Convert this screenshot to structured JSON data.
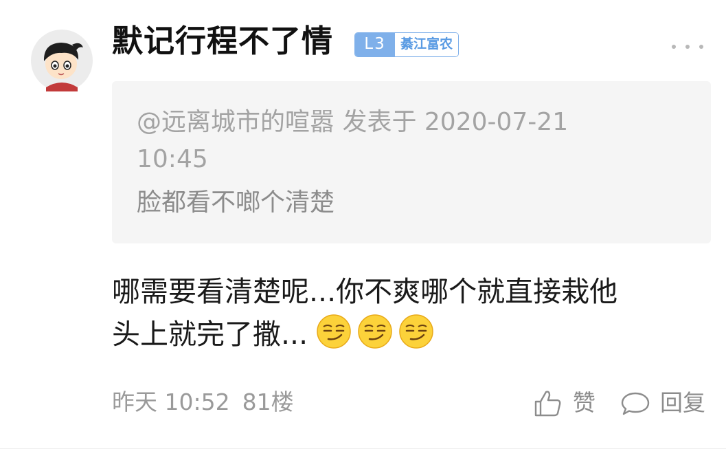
{
  "comment": {
    "username": "默记行程不了情",
    "badge": {
      "level": "L3",
      "title": "綦江富农",
      "color": "#7fb0ea"
    },
    "quote": {
      "meta": "@远离城市的喧嚣 发表于 2020-07-21 10:45",
      "body": "脸都看不啷个清楚"
    },
    "content": {
      "line1": "哪需要看清楚呢...你不爽哪个就直接栽他",
      "line2": "头上就完了撒...",
      "emojis": [
        "smirk-emoji",
        "smirk-emoji",
        "smirk-emoji"
      ]
    },
    "footer": {
      "time": "昨天 10:52",
      "floor": "81楼",
      "like_label": "赞",
      "reply_label": "回复"
    }
  },
  "icons": {
    "more": "more-icon",
    "like": "thumbs-up-icon",
    "reply": "speech-bubble-icon"
  }
}
